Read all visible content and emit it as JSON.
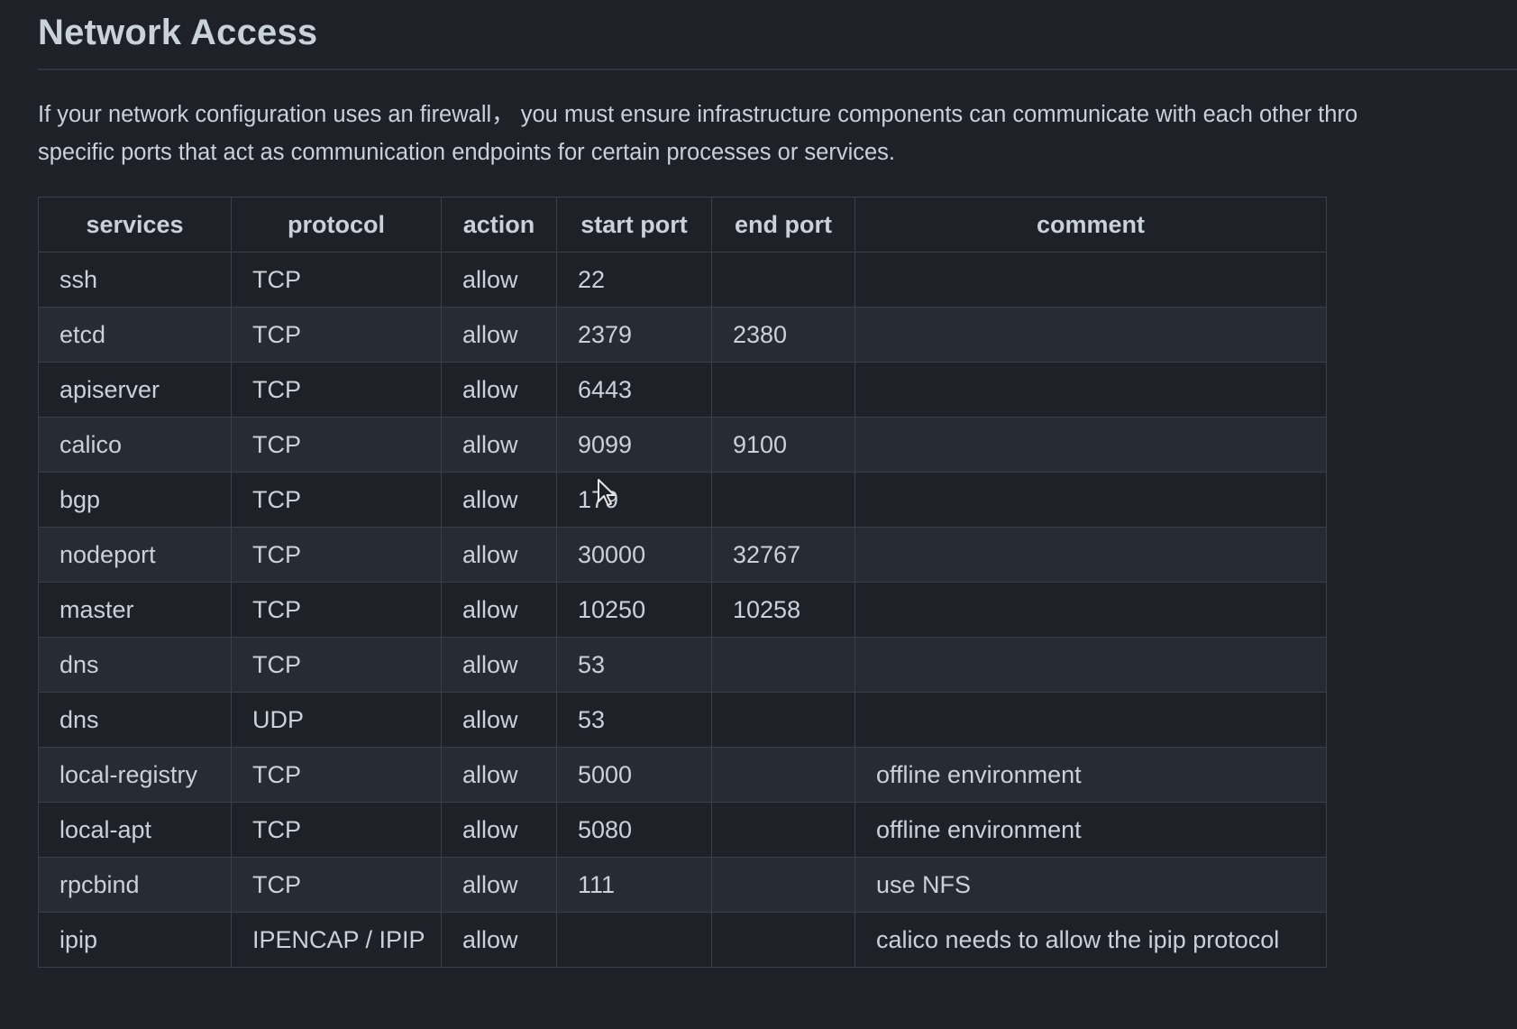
{
  "heading": "Network Access",
  "intro": {
    "line1": "If your network configuration uses an firewall， you must ensure infrastructure components can communicate with each other thro",
    "line2": "specific ports that act as communication endpoints for certain processes or services."
  },
  "table": {
    "headers": {
      "services": "services",
      "protocol": "protocol",
      "action": "action",
      "start_port": "start port",
      "end_port": "end port",
      "comment": "comment"
    },
    "rows": [
      {
        "service": "ssh",
        "protocol": "TCP",
        "action": "allow",
        "start_port": "22",
        "end_port": "",
        "comment": ""
      },
      {
        "service": "etcd",
        "protocol": "TCP",
        "action": "allow",
        "start_port": "2379",
        "end_port": "2380",
        "comment": ""
      },
      {
        "service": "apiserver",
        "protocol": "TCP",
        "action": "allow",
        "start_port": "6443",
        "end_port": "",
        "comment": ""
      },
      {
        "service": "calico",
        "protocol": "TCP",
        "action": "allow",
        "start_port": "9099",
        "end_port": "9100",
        "comment": ""
      },
      {
        "service": "bgp",
        "protocol": "TCP",
        "action": "allow",
        "start_port": "179",
        "end_port": "",
        "comment": ""
      },
      {
        "service": "nodeport",
        "protocol": "TCP",
        "action": "allow",
        "start_port": "30000",
        "end_port": "32767",
        "comment": ""
      },
      {
        "service": "master",
        "protocol": "TCP",
        "action": "allow",
        "start_port": "10250",
        "end_port": "10258",
        "comment": ""
      },
      {
        "service": "dns",
        "protocol": "TCP",
        "action": "allow",
        "start_port": "53",
        "end_port": "",
        "comment": ""
      },
      {
        "service": "dns",
        "protocol": "UDP",
        "action": "allow",
        "start_port": "53",
        "end_port": "",
        "comment": ""
      },
      {
        "service": "local-registry",
        "protocol": "TCP",
        "action": "allow",
        "start_port": "5000",
        "end_port": "",
        "comment": "offline environment"
      },
      {
        "service": "local-apt",
        "protocol": "TCP",
        "action": "allow",
        "start_port": "5080",
        "end_port": "",
        "comment": "offline environment"
      },
      {
        "service": "rpcbind",
        "protocol": "TCP",
        "action": "allow",
        "start_port": "111",
        "end_port": "",
        "comment": "use NFS"
      },
      {
        "service": "ipip",
        "protocol": "IPENCAP / IPIP",
        "action": "allow",
        "start_port": "",
        "end_port": "",
        "comment": "calico needs to allow the ipip protocol"
      }
    ]
  },
  "cursor": {
    "icon": "mouse-pointer-icon"
  },
  "colors": {
    "background": "#1e2127",
    "row_alt": "#272b33",
    "border": "#3b4048",
    "text": "#c9d1d9"
  }
}
